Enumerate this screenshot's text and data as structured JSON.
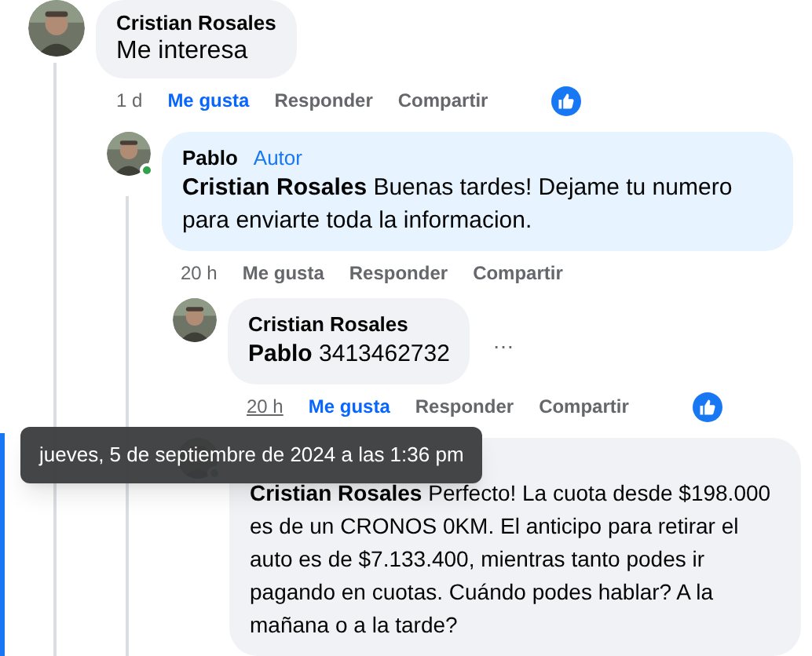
{
  "comments": [
    {
      "author": "Cristian Rosales",
      "body": "Me interesa",
      "online": false,
      "time": "1 d",
      "time_hovered": false,
      "like_label": "Me gusta",
      "liked": true,
      "reply_label": "Responder",
      "share_label": "Compartir"
    },
    {
      "author": "Pablo",
      "badge": "Autor",
      "body": "**Cristian Rosales** Buenas tardes! Dejame tu numero para enviarte toda la informacion.",
      "online": true,
      "time": "20 h",
      "time_hovered": false,
      "like_label": "Me gusta",
      "liked": false,
      "reply_label": "Responder",
      "share_label": "Compartir"
    },
    {
      "author": "Cristian Rosales",
      "body": "**Pablo** 3413462732",
      "online": false,
      "more": "…",
      "time": "20 h",
      "time_hovered": true,
      "like_label": "Me gusta",
      "liked": true,
      "reply_label": "Responder",
      "share_label": "Compartir"
    },
    {
      "body": "**Cristian Rosales** Perfecto! La cuota desde $198.000 es de un CRONOS 0KM. El anticipo para retirar el auto es de $7.133.400, mientras tanto podes ir pagando en cuotas. Cuándo podes hablar? A la mañana o a la tarde?",
      "online": true
    }
  ],
  "tooltip": "jueves, 5 de septiembre de 2024 a las 1:36 pm"
}
